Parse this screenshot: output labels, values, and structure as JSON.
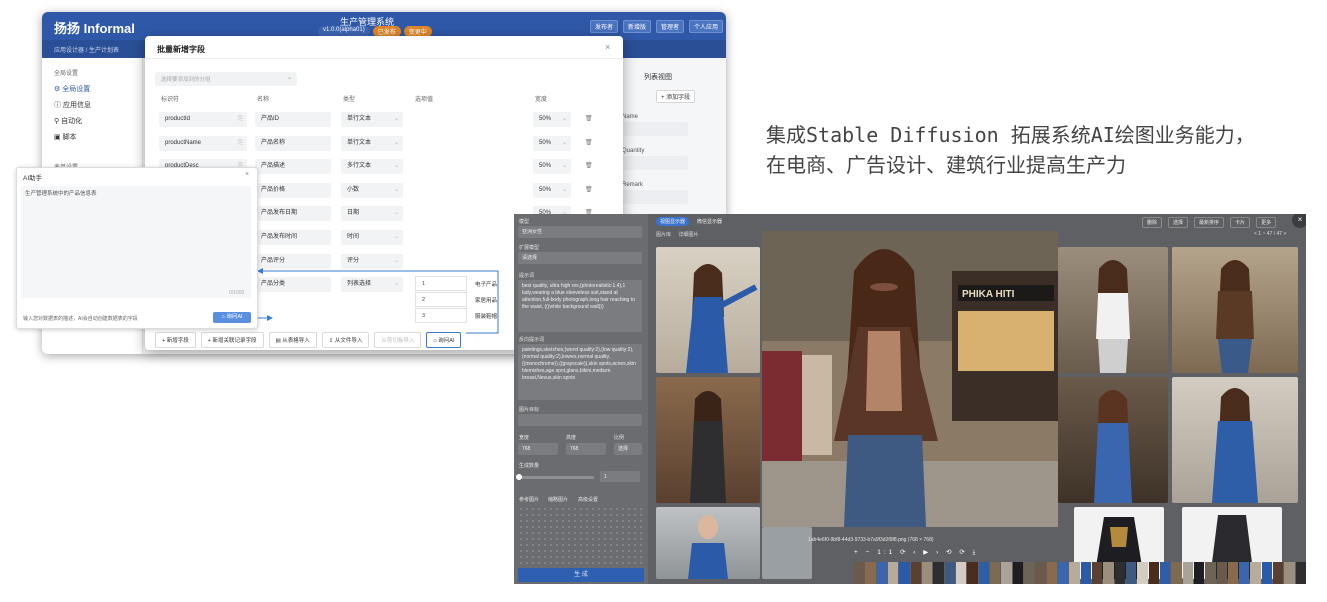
{
  "app": {
    "logo": "扬扬 Informal",
    "system_name": "生产管理系统",
    "version_badges": [
      "v1.0.0(alpha01)",
      "已发布",
      "变更中"
    ],
    "top_buttons": [
      "发布者",
      "新增版",
      "管理者",
      "个人应用"
    ],
    "breadcrumb": "应用设计器 / 生产计划表",
    "sidebar": {
      "section": "全局设置",
      "items": [
        "全局设置",
        "应用信息",
        "自动化",
        "脚本"
      ],
      "section2": "表单设置"
    },
    "right_pane": {
      "tabs": [
        "列表视图"
      ],
      "add_button": "+ 添加字段",
      "labels": [
        "Name",
        "Quantity",
        "Remark"
      ]
    }
  },
  "dialog": {
    "title": "批量新增字段",
    "close": "×",
    "group_select_placeholder": "选择要添加到的分组",
    "columns": [
      "标识符",
      "名称",
      "类型",
      "选项值",
      "宽度"
    ],
    "rows": [
      {
        "id": "productId",
        "name": "产品ID",
        "type": "单行文本",
        "width": "50%"
      },
      {
        "id": "productName",
        "name": "产品名称",
        "type": "单行文本",
        "width": "50%"
      },
      {
        "id": "productDesc",
        "name": "产品描述",
        "type": "多行文本",
        "width": "50%"
      },
      {
        "id": "",
        "name": "产品价格",
        "type": "小数",
        "width": "50%"
      },
      {
        "id": "",
        "name": "产品发布日期",
        "type": "日期",
        "width": "50%"
      },
      {
        "id": "",
        "name": "产品发布时间",
        "type": "时间",
        "width": ""
      },
      {
        "id": "",
        "name": "产品评分",
        "type": "评分",
        "width": ""
      },
      {
        "id": "",
        "name": "产品分类",
        "type": "列表选择",
        "width": ""
      }
    ],
    "options": [
      {
        "num": "1",
        "label": "电子产品"
      },
      {
        "num": "2",
        "label": "家居用品"
      },
      {
        "num": "3",
        "label": "服装鞋帽"
      }
    ],
    "footer_buttons": [
      "+ 新增字段",
      "+ 新增关联记录字段",
      "从表格导入",
      "从文件导入",
      "从剪切板导入",
      "询问AI"
    ]
  },
  "ai_helper": {
    "title": "AI助手",
    "close": "×",
    "input_text": "生产管理系统中的产品信息表",
    "counter": "0/1000",
    "hint": "输入您对数据表的描述，AI会自动创建数据表的字段",
    "ask_button": "询问AI"
  },
  "caption": {
    "line1": "集成Stable Diffusion 拓展系统AI绘图业务能力，",
    "line2": "在电商、广告设计、建筑行业提高生产力"
  },
  "sd_panel": {
    "tabs": [
      "视图显示器",
      "微信显示器"
    ],
    "tools": [
      "删除",
      "选择",
      "最新排序",
      "卡片",
      "更多"
    ],
    "close": "×",
    "sub_filters": [
      "图片库",
      "详细图片"
    ],
    "page_info": "< 1 ~ 47 / 47 >",
    "left": {
      "model_label": "模型",
      "model_value": "亚洲女性",
      "ext_label": "扩展模型",
      "ext_value": "请选择",
      "prompt_label": "提示词",
      "prompt_text": "best quality, ultra high res,(photorealistic:1.4),1 lady,wearing a blue sleeveless suit,stand at attention,full-body photograph,long hair reaching to the waist, (((white background wall)))",
      "neg_label": "反向提示词",
      "neg_text": "paintings,sketches,(worst quality:2),(low quality:2),(normal quality:2),lowres,normal quality,((monochrome)),((grayscale)),skin spots,acnes,skin blemishes,age spot,glans,bikini,medium breast,Nevus,skin spots",
      "ref_label": "图片目标",
      "width_label": "宽度",
      "height_label": "高度",
      "ratio_label": "比例",
      "width_value": "768",
      "height_value": "768",
      "ratio_value": "选择",
      "count_label": "生成数量",
      "count_value": "1",
      "ref_tabs": [
        "参考图片",
        "缩略图片",
        "高级设置"
      ],
      "generate": "生 成"
    },
    "preview_file": "1ab4e6f0-9bf8-44d3-9733-b7a9f3d2f9f8.png (768 × 768)",
    "preview_controls": "+ − 1:1 ⟳ ‹ ▶ › ⟲ ⟳ ⤓"
  }
}
